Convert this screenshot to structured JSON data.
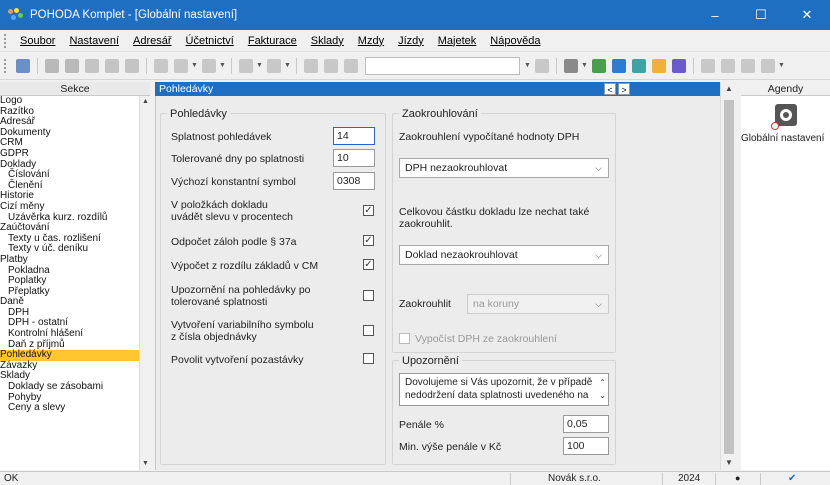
{
  "window": {
    "title": "POHODA Komplet - [Globální nastavení]",
    "controls": {
      "minimize": "–",
      "maximize": "☐",
      "close": "✕"
    }
  },
  "menu": [
    "Soubor",
    "Nastavení",
    "Adresář",
    "Účetnictví",
    "Fakturace",
    "Sklady",
    "Mzdy",
    "Jízdy",
    "Majetek",
    "Nápověda"
  ],
  "left_panel": {
    "header": "Sekce",
    "items": [
      {
        "label": "Logo",
        "level": 1
      },
      {
        "label": "Razítko",
        "level": 1
      },
      {
        "label": "Adresář",
        "level": 1
      },
      {
        "label": "Dokumenty",
        "level": 1
      },
      {
        "label": "CRM",
        "level": 1
      },
      {
        "label": "GDPR",
        "level": 1
      },
      {
        "label": "Doklady",
        "level": 1
      },
      {
        "label": "Číslování",
        "level": 2
      },
      {
        "label": "Členění",
        "level": 2
      },
      {
        "label": "Historie",
        "level": 1
      },
      {
        "label": "Cizí měny",
        "level": 1
      },
      {
        "label": "Uzávěrka kurz. rozdílů",
        "level": 2
      },
      {
        "label": "Zaúčtování",
        "level": 1
      },
      {
        "label": "Texty u čas. rozlišení",
        "level": 2
      },
      {
        "label": "Texty v úč. deníku",
        "level": 2
      },
      {
        "label": "Platby",
        "level": 1
      },
      {
        "label": "Pokladna",
        "level": 2
      },
      {
        "label": "Poplatky",
        "level": 2
      },
      {
        "label": "Přeplatky",
        "level": 2
      },
      {
        "label": "Daně",
        "level": 1
      },
      {
        "label": "DPH",
        "level": 2
      },
      {
        "label": "DPH - ostatní",
        "level": 2
      },
      {
        "label": "Kontrolní hlášení",
        "level": 2
      },
      {
        "label": "Daň z příjmů",
        "level": 2
      },
      {
        "label": "Pohledávky",
        "level": 1,
        "selected": true
      },
      {
        "label": "Závazky",
        "level": 1
      },
      {
        "label": "Sklady",
        "level": 1
      },
      {
        "label": "Doklady se zásobami",
        "level": 2
      },
      {
        "label": "Pohyby",
        "level": 2
      },
      {
        "label": "Ceny a slevy",
        "level": 2
      }
    ]
  },
  "main": {
    "header": "Pohledávky",
    "pohledavky": {
      "title": "Pohledávky",
      "splatnost_label": "Splatnost pohledávek",
      "splatnost_value": "14",
      "tolerance_label": "Tolerované dny po splatnosti",
      "tolerance_value": "10",
      "ks_label": "Výchozí konstantní symbol",
      "ks_value": "0308",
      "sleva_label_1": "V položkách dokladu",
      "sleva_label_2": "uvádět slevu v procentech",
      "sleva_checked": "✓",
      "odpocet_label": "Odpočet záloh podle § 37a",
      "odpocet_checked": "✓",
      "vypocet_label": "Výpočet z rozdílu základů v CM",
      "vypocet_checked": "✓",
      "upozorneni_label_1": "Upozornění na pohledávky po",
      "upozorneni_label_2": "tolerované splatnosti",
      "vs_label_1": "Vytvoření variabilního symbolu",
      "vs_label_2": "z čísla objednávky",
      "pozastavka_label": "Povolit vytvoření pozastávky"
    },
    "zaokrouhlovani": {
      "title": "Zaokrouhlování",
      "dph_label": "Zaokrouhlení vypočítané hodnoty DPH",
      "dph_select": "DPH nezaokrouhlovat",
      "celkova_label_1": "Celkovou částku dokladu lze nechat také",
      "celkova_label_2": "zaokrouhlit.",
      "doklad_select": "Doklad nezaokrouhlovat",
      "zaokrouhlit_label": "Zaokrouhlit",
      "zaokrouhlit_select": "na koruny",
      "vypocist_label": "Vypočíst DPH ze zaokrouhlení"
    },
    "upozorneni": {
      "title": "Upozornění",
      "text_1": "Dovolujeme si Vás upozornit, že v případě",
      "text_2": "nedodržení data splatnosti uvedeného na",
      "penale_label": "Penále %",
      "penale_value": "0,05",
      "min_label": "Min. výše penále v Kč",
      "min_value": "100"
    }
  },
  "right_panel": {
    "header": "Agendy",
    "item_label": "Globální nastavení",
    "item_icon": "gear-icon"
  },
  "statusbar": {
    "left": "OK",
    "company": "Novák  s.r.o.",
    "year": "2024"
  },
  "colors": {
    "title_blue": "#1e6fc2",
    "selection_yellow": "#ffc630"
  }
}
